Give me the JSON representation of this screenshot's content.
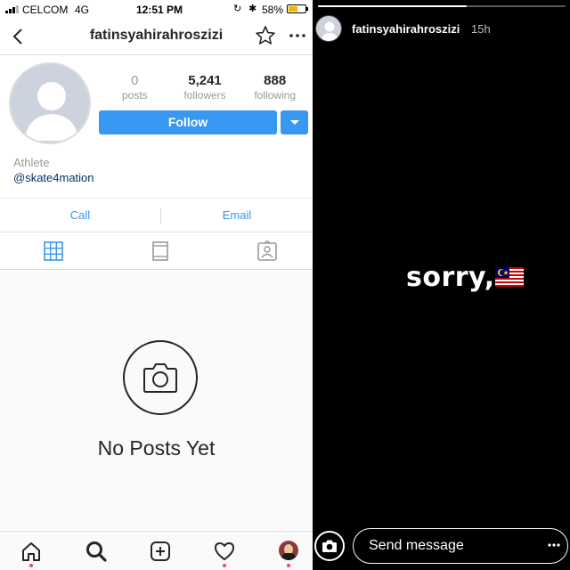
{
  "status_bar": {
    "carrier": "CELCOM",
    "network": "4G",
    "time": "12:51 PM",
    "battery_percent": "58%",
    "battery_level": 0.58,
    "icons": [
      "signal-icon",
      "rotation-lock-icon",
      "bluetooth-icon",
      "battery-icon"
    ]
  },
  "header": {
    "username": "fatinsyahirahroszizi",
    "icons": [
      "back-arrow-icon",
      "star-icon",
      "more-icon"
    ]
  },
  "profile": {
    "stats": [
      {
        "value": "0",
        "label": "posts"
      },
      {
        "value": "5,241",
        "label": "followers"
      },
      {
        "value": "888",
        "label": "following"
      }
    ],
    "follow_label": "Follow",
    "category": "Athlete",
    "handle_link": "@skate4mation",
    "contact": {
      "call": "Call",
      "email": "Email"
    },
    "view_tabs": [
      "grid-icon",
      "feed-icon",
      "tagged-icon"
    ],
    "empty_state": "No Posts Yet"
  },
  "tab_bar": {
    "items": [
      "home-icon",
      "search-icon",
      "add-icon",
      "heart-icon",
      "profile-avatar"
    ]
  },
  "story": {
    "username": "fatinsyahirahroszizi",
    "time_ago": "15h",
    "text": "sorry,",
    "emoji": "malaysia-flag",
    "send_placeholder": "Send message",
    "progress": 0.6
  },
  "colors": {
    "accent": "#3897f0",
    "link": "#003569",
    "notification_dot": "#ed4956",
    "story_bg": "#000000"
  }
}
